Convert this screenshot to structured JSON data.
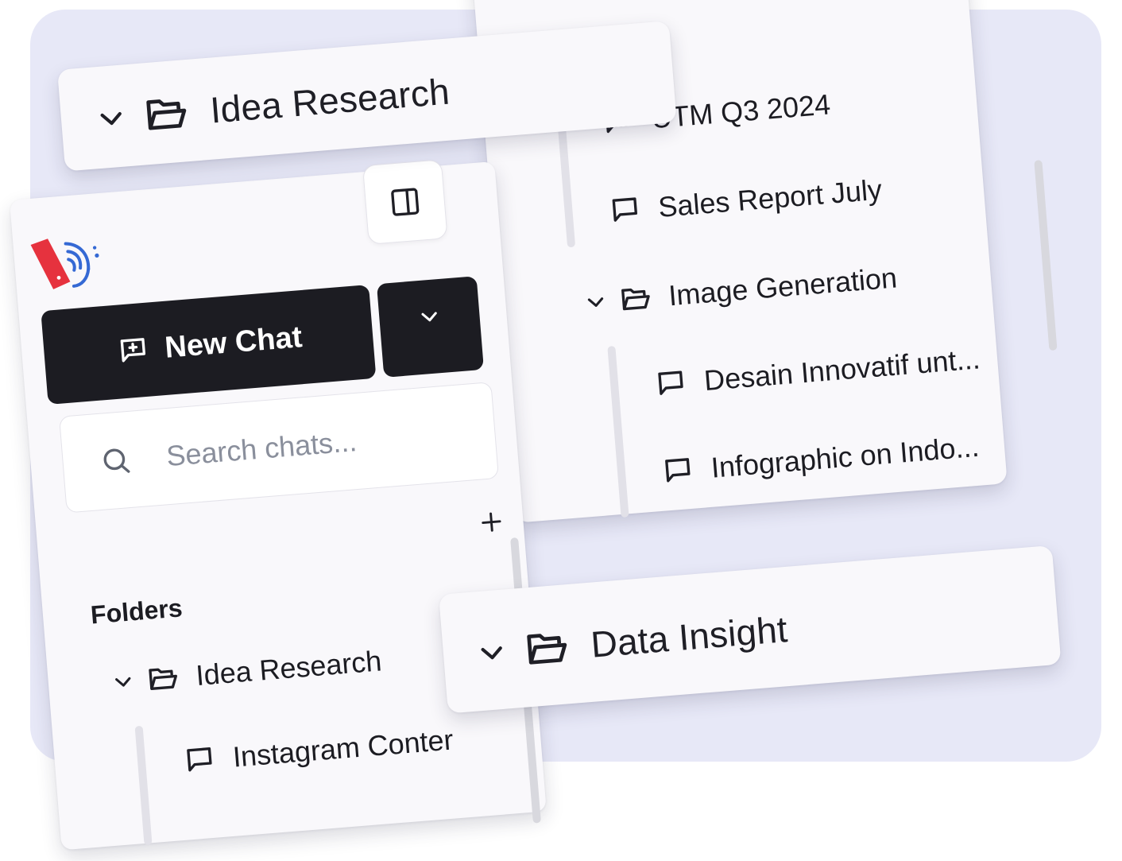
{
  "floating_cards": {
    "idea_research": {
      "label": "Idea Research"
    },
    "data_insight": {
      "label": "Data Insight"
    }
  },
  "sidebar": {
    "new_chat_label": "New Chat",
    "search_placeholder": "Search chats...",
    "folders_heading": "Folders",
    "folders": [
      {
        "label": "Idea Research",
        "chats": [
          {
            "label": "Instagram Conter"
          }
        ]
      }
    ]
  },
  "right_panel": {
    "chats": [
      {
        "label": "UTM Q3 2024"
      },
      {
        "label": "Sales Report July"
      }
    ],
    "folders": [
      {
        "label": "Image Generation",
        "chats": [
          {
            "label": "Desain Innovatif unt..."
          },
          {
            "label": "Infographic on Indo..."
          }
        ]
      }
    ]
  },
  "icons": {
    "chevron": "chevron-down-icon",
    "folder": "folder-open-icon",
    "chat": "message-square-icon",
    "new_chat": "message-square-plus-icon",
    "add": "plus-icon",
    "panel": "panel-right-icon",
    "search": "search-icon",
    "logo": "brand-logo"
  },
  "colors": {
    "frame_bg": "#e7e8f7",
    "card_bg": "#f9f8fb",
    "dark_button": "#1c1c22",
    "logo_red": "#e6323e",
    "logo_blue": "#3569d4",
    "placeholder": "#8a8f9c"
  }
}
